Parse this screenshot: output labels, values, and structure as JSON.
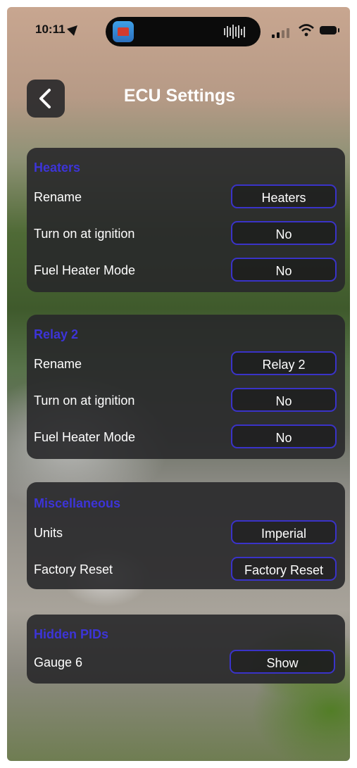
{
  "status_bar": {
    "time": "10:11"
  },
  "header": {
    "title": "ECU Settings"
  },
  "sections": [
    {
      "title": "Heaters",
      "rows": [
        {
          "label": "Rename",
          "value": "Heaters"
        },
        {
          "label": "Turn on at ignition",
          "value": "No"
        },
        {
          "label": "Fuel Heater Mode",
          "value": "No"
        }
      ]
    },
    {
      "title": "Relay 2",
      "rows": [
        {
          "label": "Rename",
          "value": "Relay 2"
        },
        {
          "label": "Turn on at ignition",
          "value": "No"
        },
        {
          "label": "Fuel Heater Mode",
          "value": "No"
        }
      ]
    },
    {
      "title": "Miscellaneous",
      "rows": [
        {
          "label": "Units",
          "value": "Imperial"
        },
        {
          "label": "Factory Reset",
          "value": "Factory Reset"
        }
      ]
    },
    {
      "title": "Hidden PIDs",
      "rows": [
        {
          "label": "Gauge 6",
          "value": "Show"
        }
      ]
    }
  ],
  "colors": {
    "accent": "#3d34d8",
    "card_bg": "#28282a",
    "pill_border": "#3a33c8"
  },
  "icons": [
    "location-arrow-icon",
    "app-icon",
    "signal-icon",
    "wifi-icon",
    "battery-icon",
    "chevron-left-icon"
  ]
}
